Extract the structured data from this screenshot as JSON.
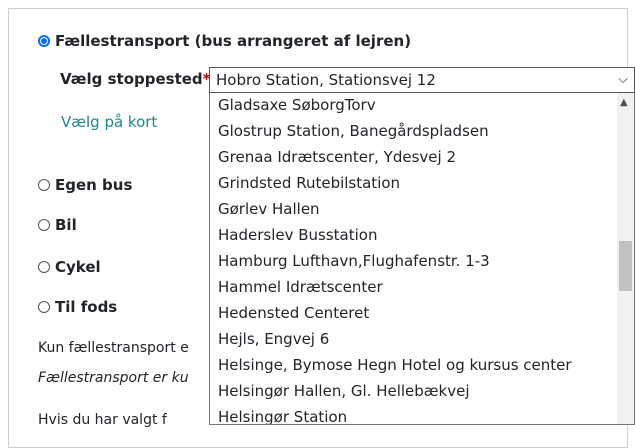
{
  "transport_options": {
    "shared": "Fællestransport (bus arrangeret af lejren)",
    "own_bus": "Egen bus",
    "car": "Bil",
    "bike": "Cykel",
    "walk": "Til fods"
  },
  "stop": {
    "label": "Vælg stoppested",
    "required_mark": "*",
    "selected": "Hobro Station, Stationsvej 12",
    "chevron": "chevron-down-icon"
  },
  "map_link": "Vælg på kort",
  "info_lines": [
    "Kun fællestransport e",
    "Fællestransport er ku",
    "Hvis du har valgt f"
  ],
  "dropdown_options": [
    "Gladsaxe SøborgTorv",
    "Glostrup Station, Banegårdspladsen",
    "Grenaa Idrætscenter, Ydesvej 2",
    "Grindsted Rutebilstation",
    "Gørlev Hallen",
    "Haderslev Busstation",
    "Hamburg Lufthavn,Flughafenstr. 1-3",
    "Hammel Idrætscenter",
    "Hedensted Centeret",
    "Hejls, Engvej 6",
    "Helsinge, Bymose Hegn Hotel og kursus center",
    "Helsingør Hallen, Gl. Hellebækvej",
    "Helsingør Station"
  ],
  "colors": {
    "accent": "#0d6efd",
    "link": "#1a8a8a",
    "required": "#c00000"
  }
}
